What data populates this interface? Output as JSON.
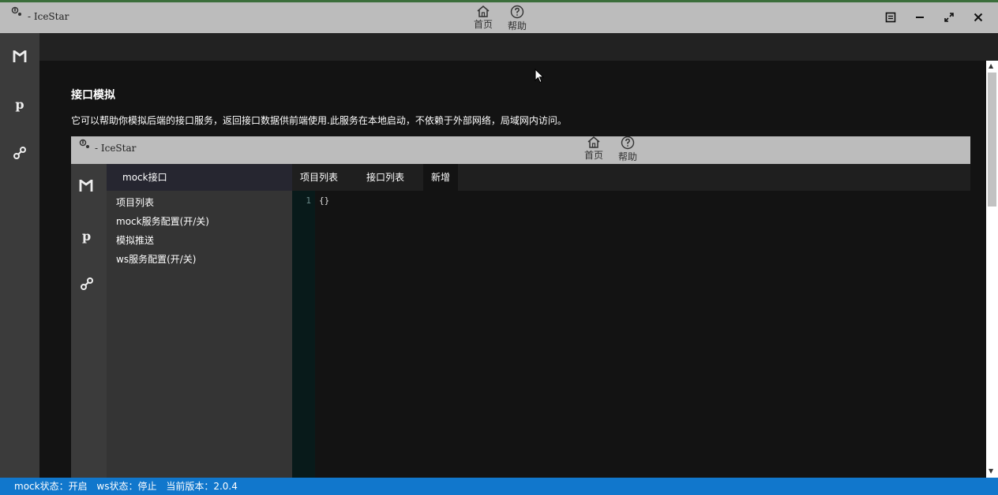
{
  "app": {
    "title": "- IceStar",
    "nav": [
      {
        "label": "首页",
        "icon": "home-icon"
      },
      {
        "label": "帮助",
        "icon": "help-icon"
      }
    ]
  },
  "sidebar": {
    "items": [
      {
        "label": "M",
        "icon": "mock-icon"
      },
      {
        "label": "p",
        "icon": "p-icon"
      },
      {
        "label": "",
        "icon": "link-icon"
      }
    ]
  },
  "main": {
    "heading": "接口模拟",
    "description": "它可以帮助你模拟后端的接口服务，返回接口数据供前端使用.此服务在本地启动，不依赖于外部网络，局域网内访问。"
  },
  "screenshot": {
    "title": "- IceStar",
    "nav": [
      {
        "label": "首页",
        "icon": "home-icon"
      },
      {
        "label": "帮助",
        "icon": "help-icon"
      }
    ],
    "panel_title": "mock接口",
    "menu": [
      "项目列表",
      "mock服务配置(开/关)",
      "模拟推送",
      "ws服务配置(开/关)"
    ],
    "tabs": [
      "项目列表",
      "接口列表",
      "新增"
    ],
    "active_tab": "新增",
    "editor": {
      "line_number": "1",
      "content": "{}"
    }
  },
  "status": {
    "mock": "mock状态：开启",
    "ws": "ws状态：停止",
    "version_label": "当前版本：",
    "version": "2.0.4"
  }
}
